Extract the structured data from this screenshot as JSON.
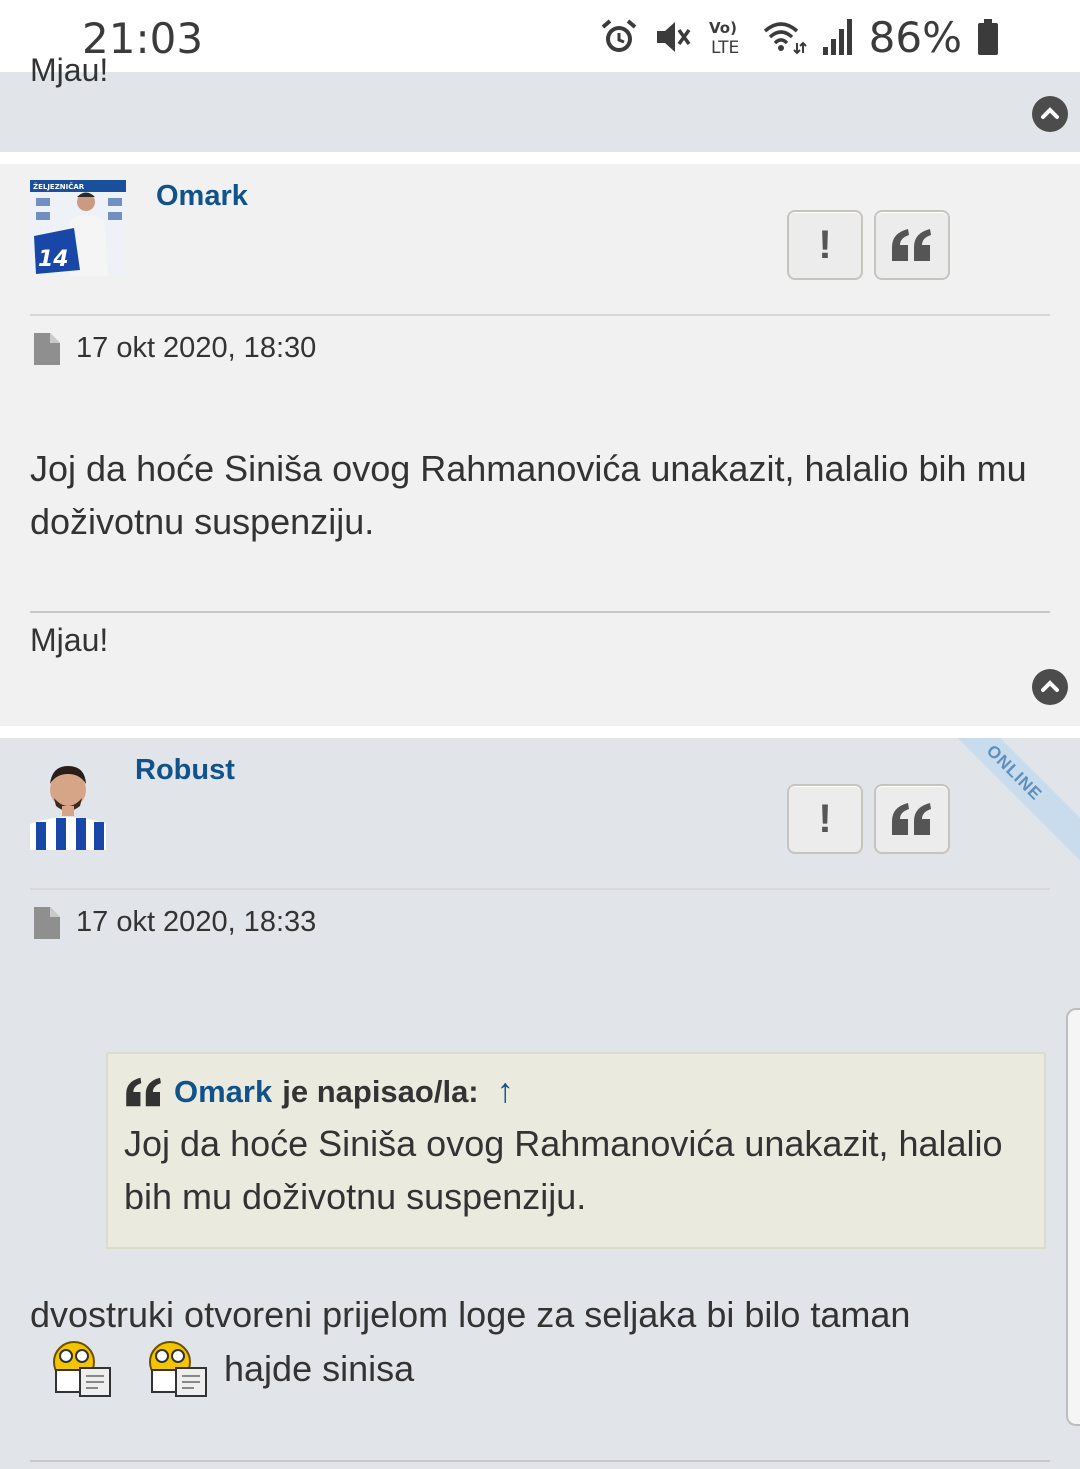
{
  "status_bar": {
    "time": "21:03",
    "battery_percent": "86%",
    "icons": [
      "alarm-icon",
      "mute-icon",
      "volte-icon",
      "wifi-icon",
      "signal-icon",
      "battery-icon"
    ],
    "volte_top": "Vo)",
    "volte_bottom": "LTE"
  },
  "previous_post": {
    "signature_partial": "Mjau!"
  },
  "post_omark": {
    "username": "Omark",
    "date": "17 okt 2020, 18:30",
    "report_label": "!",
    "body": "Joj da hoće Siniša ovog Rahmanovića unakazit, halalio bih mu doživotnu suspenziju.",
    "signature": "Mjau!"
  },
  "post_robust": {
    "username": "Robust",
    "online_badge": "ONLINE",
    "date": "17 okt 2020, 18:33",
    "report_label": "!",
    "quote": {
      "author": "Omark",
      "wrote": "je napisao/la:",
      "up_arrow": "↑",
      "text": "Joj da hoće Siniša ovog Rahmanovića unakazit, halalio bih mu doživotnu suspenziju."
    },
    "body_line1": "dvostruki otvoreni prijelom loge za seljaka bi bilo taman",
    "body_line2": "hajde sinisa"
  },
  "colors": {
    "username": "#105289",
    "panel_gray": "#e1e4e8",
    "panel_light": "#f1f1f1",
    "quote_bg": "#ebeadf"
  }
}
